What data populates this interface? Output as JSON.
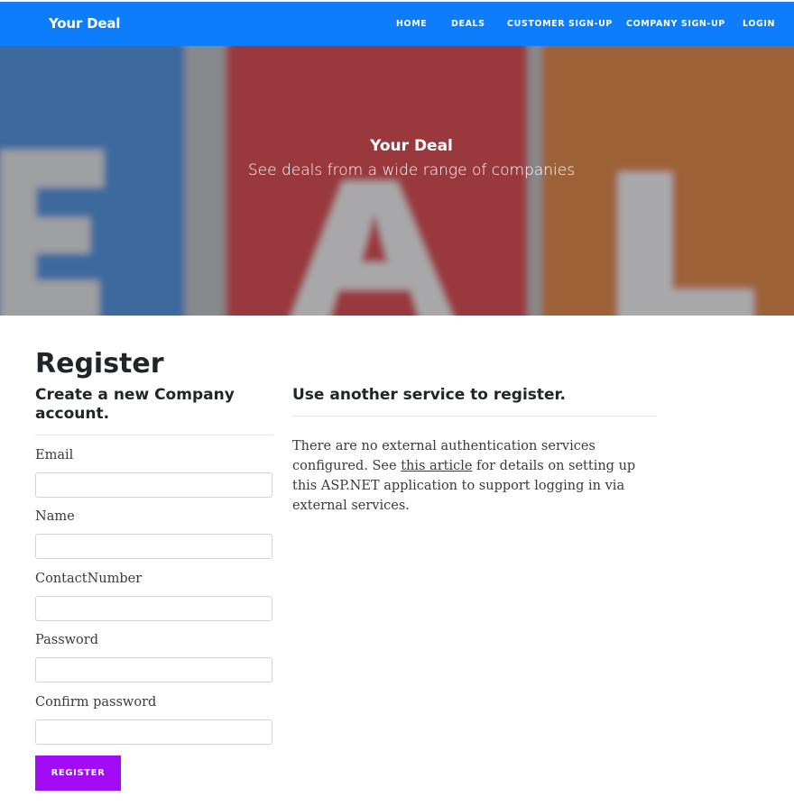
{
  "navbar": {
    "brand": "Your Deal",
    "links": [
      "HOME",
      "DEALS",
      "CUSTOMER SIGN-UP",
      "COMPANY SIGN-UP",
      "LOGIN"
    ],
    "color": "#0d7dfc"
  },
  "hero": {
    "title": "Your Deal",
    "subtitle": "See deals from a wide range of companies"
  },
  "page": {
    "title": "Register",
    "form_title": "Create a new Company account.",
    "fields": [
      {
        "label": "Email",
        "value": ""
      },
      {
        "label": "Name",
        "value": ""
      },
      {
        "label": "ContactNumber",
        "value": ""
      },
      {
        "label": "Password",
        "value": ""
      },
      {
        "label": "Confirm password",
        "value": ""
      }
    ],
    "submit_label": "REGISTER",
    "submit_color": "#a10cf5"
  },
  "external": {
    "title": "Use another service to register.",
    "text_before": "There are no external authentication services configured. See ",
    "link_text": "this article",
    "text_after": " for details on setting up this ASP.NET application to support logging in via external services."
  }
}
